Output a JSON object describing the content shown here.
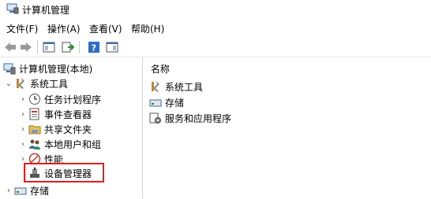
{
  "window": {
    "title": "计算机管理"
  },
  "menu": {
    "items": [
      "文件(F)",
      "操作(A)",
      "查看(V)",
      "帮助(H)"
    ]
  },
  "tree": {
    "root": "计算机管理(本地)",
    "system_tools": "系统工具",
    "children": [
      "任务计划程序",
      "事件查看器",
      "共享文件夹",
      "本地用户和组",
      "性能",
      "设备管理器"
    ],
    "storage": "存储"
  },
  "right": {
    "header": "名称",
    "items": [
      "系统工具",
      "存储",
      "服务和应用程序"
    ]
  },
  "colors": {
    "highlight": "#e01e1e"
  }
}
